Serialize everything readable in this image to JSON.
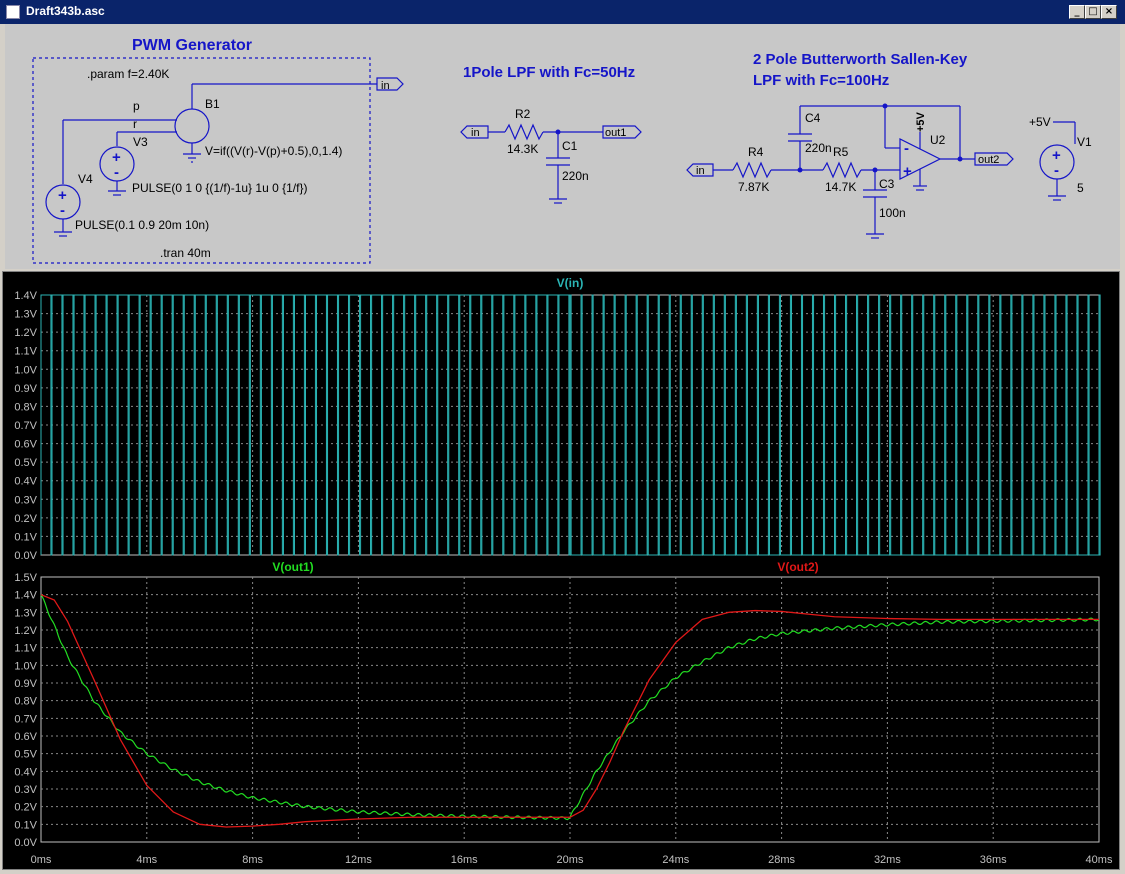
{
  "window": {
    "title": "Draft343b.asc",
    "minimize": "_",
    "maximize": "□",
    "close": "×"
  },
  "schematic": {
    "pwm_title": "PWM Generator",
    "param": ".param f=2.40K",
    "net_in": "in",
    "label_p": "p",
    "label_r": "r",
    "b1": "B1",
    "b1_expr": "V=if((V(r)-V(p)+0.5),0,1.4)",
    "v3": "V3",
    "v3_pulse": "PULSE(0 1 0 {(1/f)-1u} 1u 0 {1/f})",
    "v4": "V4",
    "v4_pulse": "PULSE(0.1 0.9 20m 10n)",
    "tran": ".tran 40m",
    "lpf1_title": "1Pole LPF with Fc=50Hz",
    "lpf1_in": "in",
    "r2": "R2",
    "r2_val": "14.3K",
    "c1": "C1",
    "c1_val": "220n",
    "out1": "out1",
    "sk_title1": "2 Pole Butterworth Sallen-Key",
    "sk_title2": "LPF with Fc=100Hz",
    "sk_in": "in",
    "r4": "R4",
    "r4_val": "7.87K",
    "c4": "C4",
    "c4_val": "220n",
    "r5": "R5",
    "r5_val": "14.7K",
    "c3": "C3",
    "c3_val": "100n",
    "u2": "U2",
    "plus5_u2": "+5V",
    "out2": "out2",
    "v1_net": "+5V",
    "v1": "V1",
    "v1_val": "5"
  },
  "colors": {
    "in": "#2bb5b5",
    "out1": "#22dd22",
    "out2": "#e01818",
    "grid": "#888888",
    "axis": "#c0c0c0",
    "schematic_blue": "#1515c8"
  },
  "chart_data": [
    {
      "type": "line",
      "title": "V(in)",
      "series": [
        {
          "name": "V(in)",
          "color": "#2bb5b5",
          "description": "PWM square wave 0V to 1.4V at 2.4kHz"
        }
      ],
      "xlim": [
        0,
        40
      ],
      "x_unit": "ms",
      "ylim": [
        0,
        1.4
      ],
      "yticks": [
        "0.0V",
        "0.1V",
        "0.2V",
        "0.3V",
        "0.4V",
        "0.5V",
        "0.6V",
        "0.7V",
        "0.8V",
        "0.9V",
        "1.0V",
        "1.1V",
        "1.2V",
        "1.3V",
        "1.4V"
      ],
      "grid": true
    },
    {
      "type": "line",
      "xlim": [
        0,
        40
      ],
      "x_unit": "ms",
      "ylim": [
        0,
        1.5
      ],
      "xticks": [
        "0ms",
        "4ms",
        "8ms",
        "12ms",
        "16ms",
        "20ms",
        "24ms",
        "28ms",
        "32ms",
        "36ms",
        "40ms"
      ],
      "yticks": [
        "0.0V",
        "0.1V",
        "0.2V",
        "0.3V",
        "0.4V",
        "0.5V",
        "0.6V",
        "0.7V",
        "0.8V",
        "0.9V",
        "1.0V",
        "1.1V",
        "1.2V",
        "1.3V",
        "1.4V",
        "1.5V"
      ],
      "grid": true,
      "series": [
        {
          "name": "V(out1)",
          "color": "#22dd22",
          "x": [
            0,
            1,
            2,
            3,
            4,
            5,
            6,
            7,
            8,
            10,
            12,
            14,
            16,
            18,
            19.9,
            20,
            20.5,
            21,
            22,
            23,
            24,
            25,
            26,
            27,
            28,
            30,
            32,
            34,
            36,
            38,
            40
          ],
          "y": [
            1.4,
            1.05,
            0.8,
            0.62,
            0.5,
            0.41,
            0.34,
            0.29,
            0.25,
            0.2,
            0.17,
            0.155,
            0.145,
            0.14,
            0.135,
            0.14,
            0.27,
            0.4,
            0.62,
            0.8,
            0.93,
            1.02,
            1.1,
            1.15,
            1.18,
            1.21,
            1.23,
            1.245,
            1.25,
            1.255,
            1.26
          ]
        },
        {
          "name": "V(out2)",
          "color": "#e01818",
          "x": [
            0,
            0.5,
            1,
            2,
            3,
            4,
            5,
            6,
            7,
            8,
            9,
            10,
            12,
            14,
            16,
            18,
            20,
            20.5,
            21,
            21.5,
            22,
            23,
            24,
            25,
            26,
            27,
            28,
            29,
            30,
            32,
            34,
            36,
            38,
            40
          ],
          "y": [
            1.4,
            1.37,
            1.25,
            0.92,
            0.58,
            0.32,
            0.17,
            0.1,
            0.085,
            0.09,
            0.1,
            0.115,
            0.13,
            0.14,
            0.14,
            0.14,
            0.14,
            0.18,
            0.3,
            0.45,
            0.62,
            0.92,
            1.13,
            1.26,
            1.3,
            1.31,
            1.305,
            1.29,
            1.275,
            1.265,
            1.26,
            1.26,
            1.26,
            1.26
          ]
        }
      ]
    }
  ]
}
